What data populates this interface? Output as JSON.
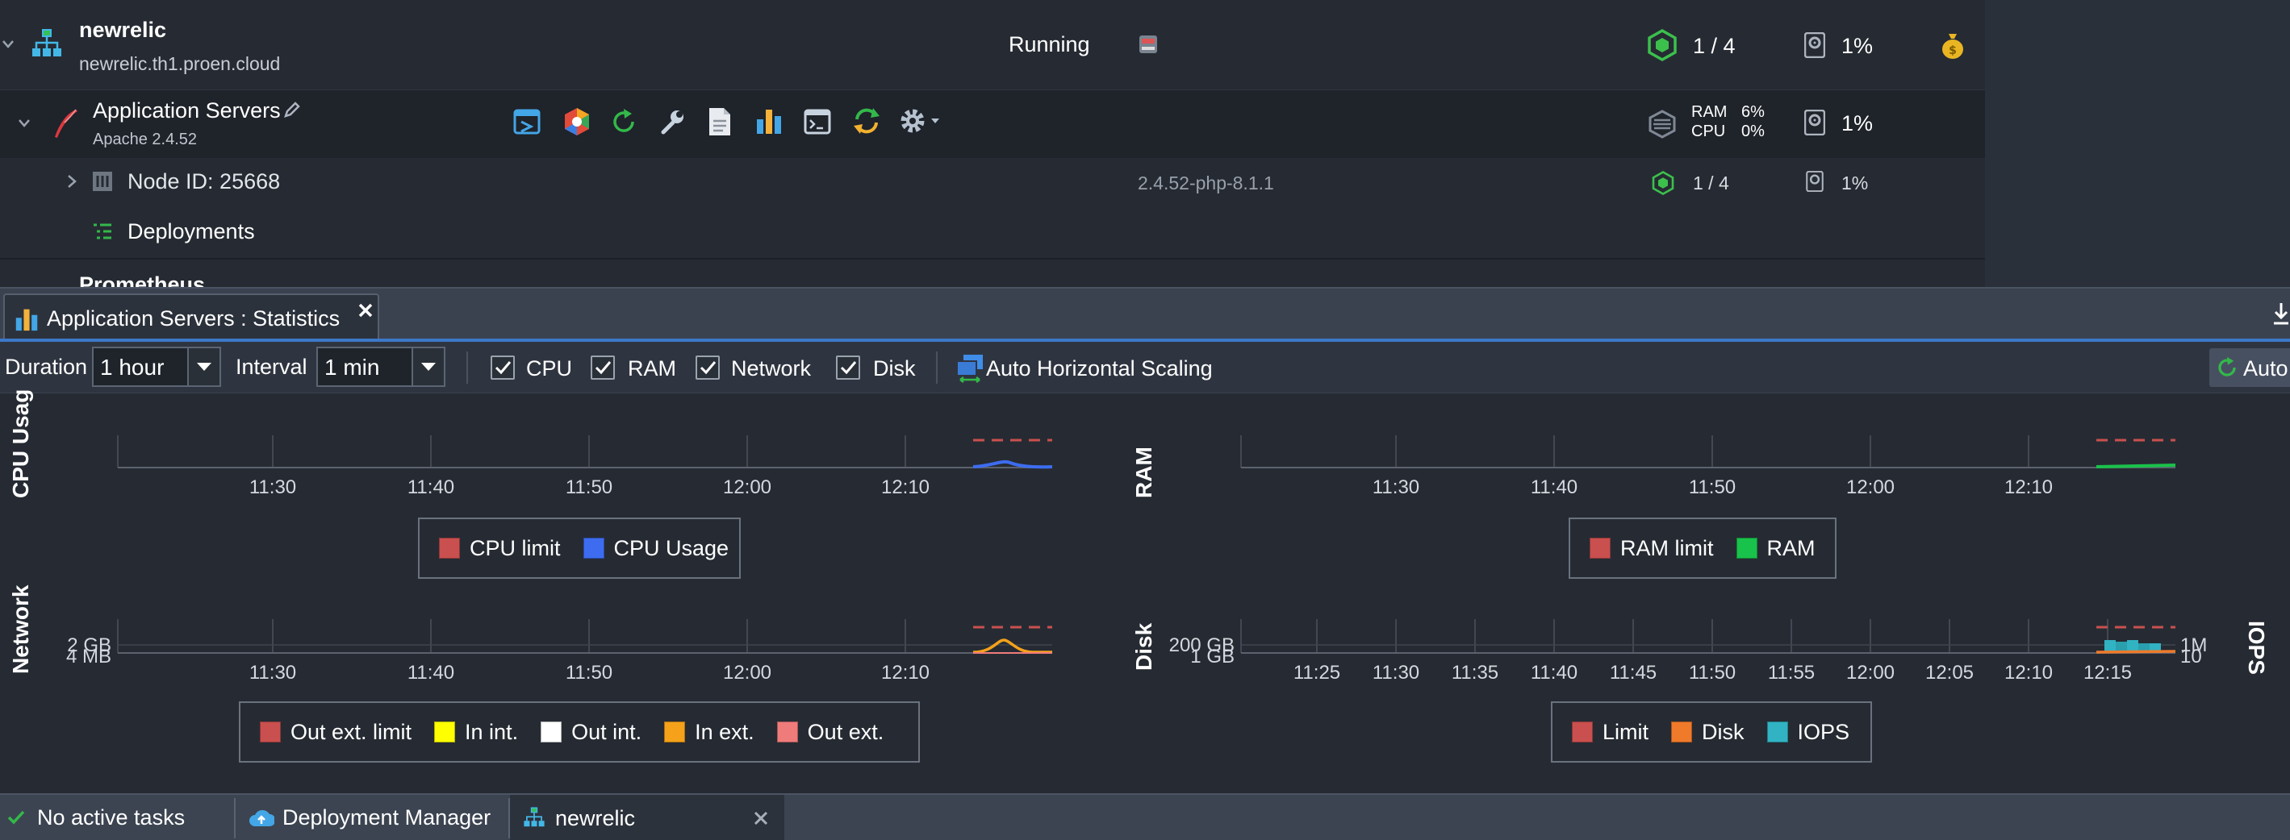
{
  "env": {
    "name": "newrelic",
    "domain": "newrelic.th1.proen.cloud",
    "status": "Running",
    "cloudlets": "1 / 4",
    "disk": "1%"
  },
  "app_servers": {
    "title": "Application Servers",
    "version": "Apache 2.4.52",
    "ram_label": "RAM",
    "ram_value": "6%",
    "cpu_label": "CPU",
    "cpu_value": "0%",
    "disk": "1%"
  },
  "node": {
    "label": "Node ID: 25668",
    "tag": "2.4.52-php-8.1.1",
    "cloudlets": "1 / 4",
    "disk": "1%"
  },
  "deployments": {
    "label": "Deployments"
  },
  "peek_label": "Prometheus",
  "stats_tab": {
    "title": "Application Servers : Statistics"
  },
  "toolbar": {
    "duration_label": "Duration",
    "duration_value": "1 hour",
    "interval_label": "Interval",
    "interval_value": "1 min",
    "cpu": "CPU",
    "ram": "RAM",
    "network": "Network",
    "disk": "Disk",
    "auto_scaling": "Auto Horizontal Scaling",
    "auto_refresh": "Auto"
  },
  "colors": {
    "limit": "#c9504f",
    "cpu": "#3d6cf0",
    "ram": "#19c24a",
    "in_int": "#ffff00",
    "out_int": "#ffffff",
    "in_ext": "#f5a21a",
    "out_ext": "#f07b7b",
    "disk": "#ef7a2a",
    "iops": "#31b3c3",
    "accent": "#3c78c8"
  },
  "chart_data": [
    {
      "type": "line",
      "ylabel": "CPU Usag",
      "x_ticks": [
        "11:30",
        "11:40",
        "11:50",
        "12:00",
        "12:10"
      ],
      "series": [
        {
          "name": "CPU limit",
          "color": "#c9504f",
          "style": "dashed"
        },
        {
          "name": "CPU Usage",
          "color": "#3d6cf0"
        }
      ],
      "legend": "bottom"
    },
    {
      "type": "line",
      "ylabel": "RAM",
      "x_ticks": [
        "11:30",
        "11:40",
        "11:50",
        "12:00",
        "12:10"
      ],
      "series": [
        {
          "name": "RAM limit",
          "color": "#c9504f",
          "style": "dashed"
        },
        {
          "name": "RAM",
          "color": "#19c24a"
        }
      ],
      "legend": "bottom"
    },
    {
      "type": "line",
      "ylabel": "Network",
      "y_ticks": [
        "2 GB",
        "4 MB"
      ],
      "x_ticks": [
        "11:30",
        "11:40",
        "11:50",
        "12:00",
        "12:10"
      ],
      "series": [
        {
          "name": "Out ext. limit",
          "color": "#c9504f",
          "style": "dashed"
        },
        {
          "name": "In int.",
          "color": "#ffff00"
        },
        {
          "name": "Out int.",
          "color": "#ffffff"
        },
        {
          "name": "In ext.",
          "color": "#f5a21a"
        },
        {
          "name": "Out ext.",
          "color": "#f07b7b"
        }
      ],
      "legend": "bottom"
    },
    {
      "type": "line",
      "ylabel": "Disk",
      "y2label": "IOPS",
      "y_ticks": [
        "200 GB",
        "1 GB"
      ],
      "y2_ticks": [
        "1M",
        "10"
      ],
      "x_ticks": [
        "11:25",
        "11:30",
        "11:35",
        "11:40",
        "11:45",
        "11:50",
        "11:55",
        "12:00",
        "12:05",
        "12:10",
        "12:15"
      ],
      "series": [
        {
          "name": "Limit",
          "color": "#c9504f",
          "style": "dashed"
        },
        {
          "name": "Disk",
          "color": "#ef7a2a"
        },
        {
          "name": "IOPS",
          "color": "#31b3c3"
        }
      ],
      "legend": "bottom"
    }
  ],
  "taskbar": {
    "status": "No active tasks",
    "deployment_manager": "Deployment Manager",
    "env_tab": "newrelic"
  }
}
